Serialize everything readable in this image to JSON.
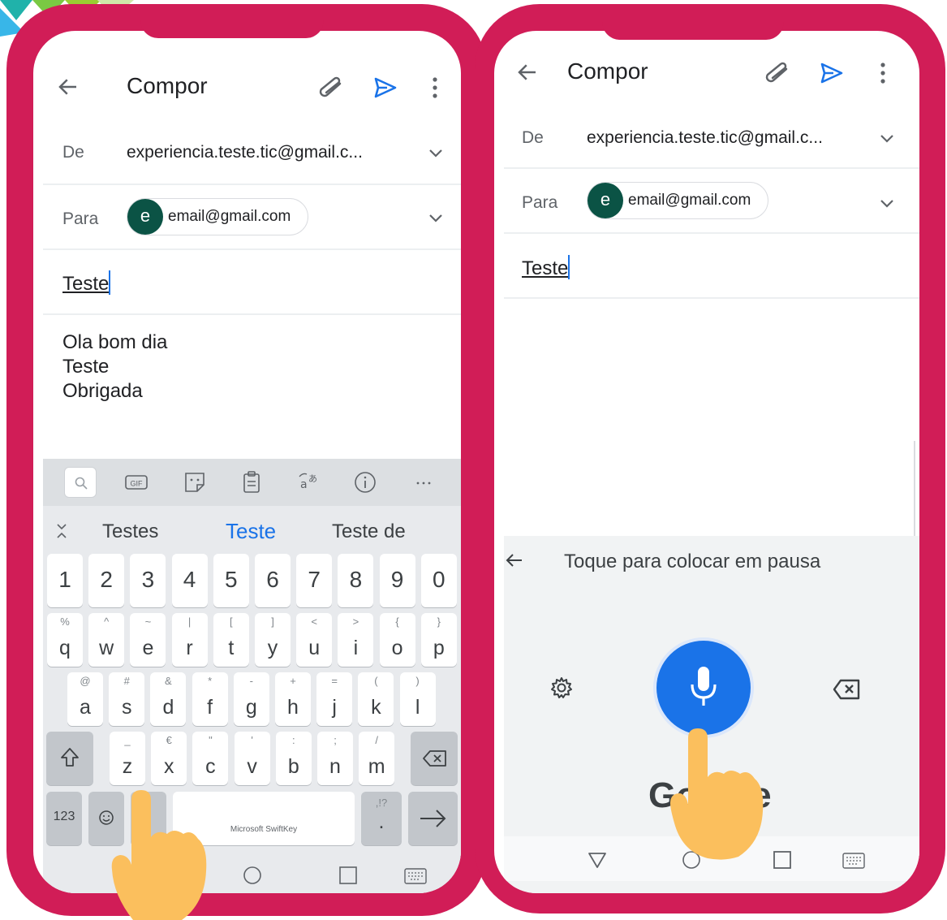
{
  "left_screen": {
    "title": "Compor",
    "from_label": "De",
    "from_value": "experiencia.teste.tic@gmail.c...",
    "to_label": "Para",
    "to_avatar_letter": "e",
    "to_chip": "email@gmail.com",
    "subject": "Teste",
    "body_lines": [
      "Ola bom dia",
      "Teste",
      "Obrigada"
    ],
    "keyboard": {
      "suggestions": [
        "Testes",
        "Teste",
        "Teste de"
      ],
      "number_row": [
        "1",
        "2",
        "3",
        "4",
        "5",
        "6",
        "7",
        "8",
        "9",
        "0"
      ],
      "row1": [
        {
          "main": "q",
          "sec": "%"
        },
        {
          "main": "w",
          "sec": "^"
        },
        {
          "main": "e",
          "sec": "~"
        },
        {
          "main": "r",
          "sec": "|"
        },
        {
          "main": "t",
          "sec": "["
        },
        {
          "main": "y",
          "sec": "]"
        },
        {
          "main": "u",
          "sec": "<"
        },
        {
          "main": "i",
          "sec": ">"
        },
        {
          "main": "o",
          "sec": "{"
        },
        {
          "main": "p",
          "sec": "}"
        }
      ],
      "row2": [
        {
          "main": "a",
          "sec": "@"
        },
        {
          "main": "s",
          "sec": "#"
        },
        {
          "main": "d",
          "sec": "&"
        },
        {
          "main": "f",
          "sec": "*"
        },
        {
          "main": "g",
          "sec": "-"
        },
        {
          "main": "h",
          "sec": "+"
        },
        {
          "main": "j",
          "sec": "="
        },
        {
          "main": "k",
          "sec": "("
        },
        {
          "main": "l",
          "sec": ")"
        }
      ],
      "row3": [
        {
          "main": "z",
          "sec": "_"
        },
        {
          "main": "x",
          "sec": "€"
        },
        {
          "main": "c",
          "sec": "\""
        },
        {
          "main": "v",
          "sec": "'"
        },
        {
          "main": "b",
          "sec": ":"
        },
        {
          "main": "n",
          "sec": ";"
        },
        {
          "main": "m",
          "sec": "/"
        }
      ],
      "key_123": "123",
      "space_label": "Microsoft SwiftKey",
      "period_key": ".",
      "period_sec": ",!?"
    }
  },
  "right_screen": {
    "title": "Compor",
    "from_label": "De",
    "from_value": "experiencia.teste.tic@gmail.c...",
    "to_label": "Para",
    "to_avatar_letter": "e",
    "to_chip": "email@gmail.com",
    "subject": "Teste",
    "voice_hint": "Toque para colocar em pausa",
    "voice_brand": "Google"
  },
  "colors": {
    "frame": "#d11d57",
    "accent_blue": "#1a73e8",
    "avatar": "#0b5345",
    "hand": "#fbbf5d"
  }
}
